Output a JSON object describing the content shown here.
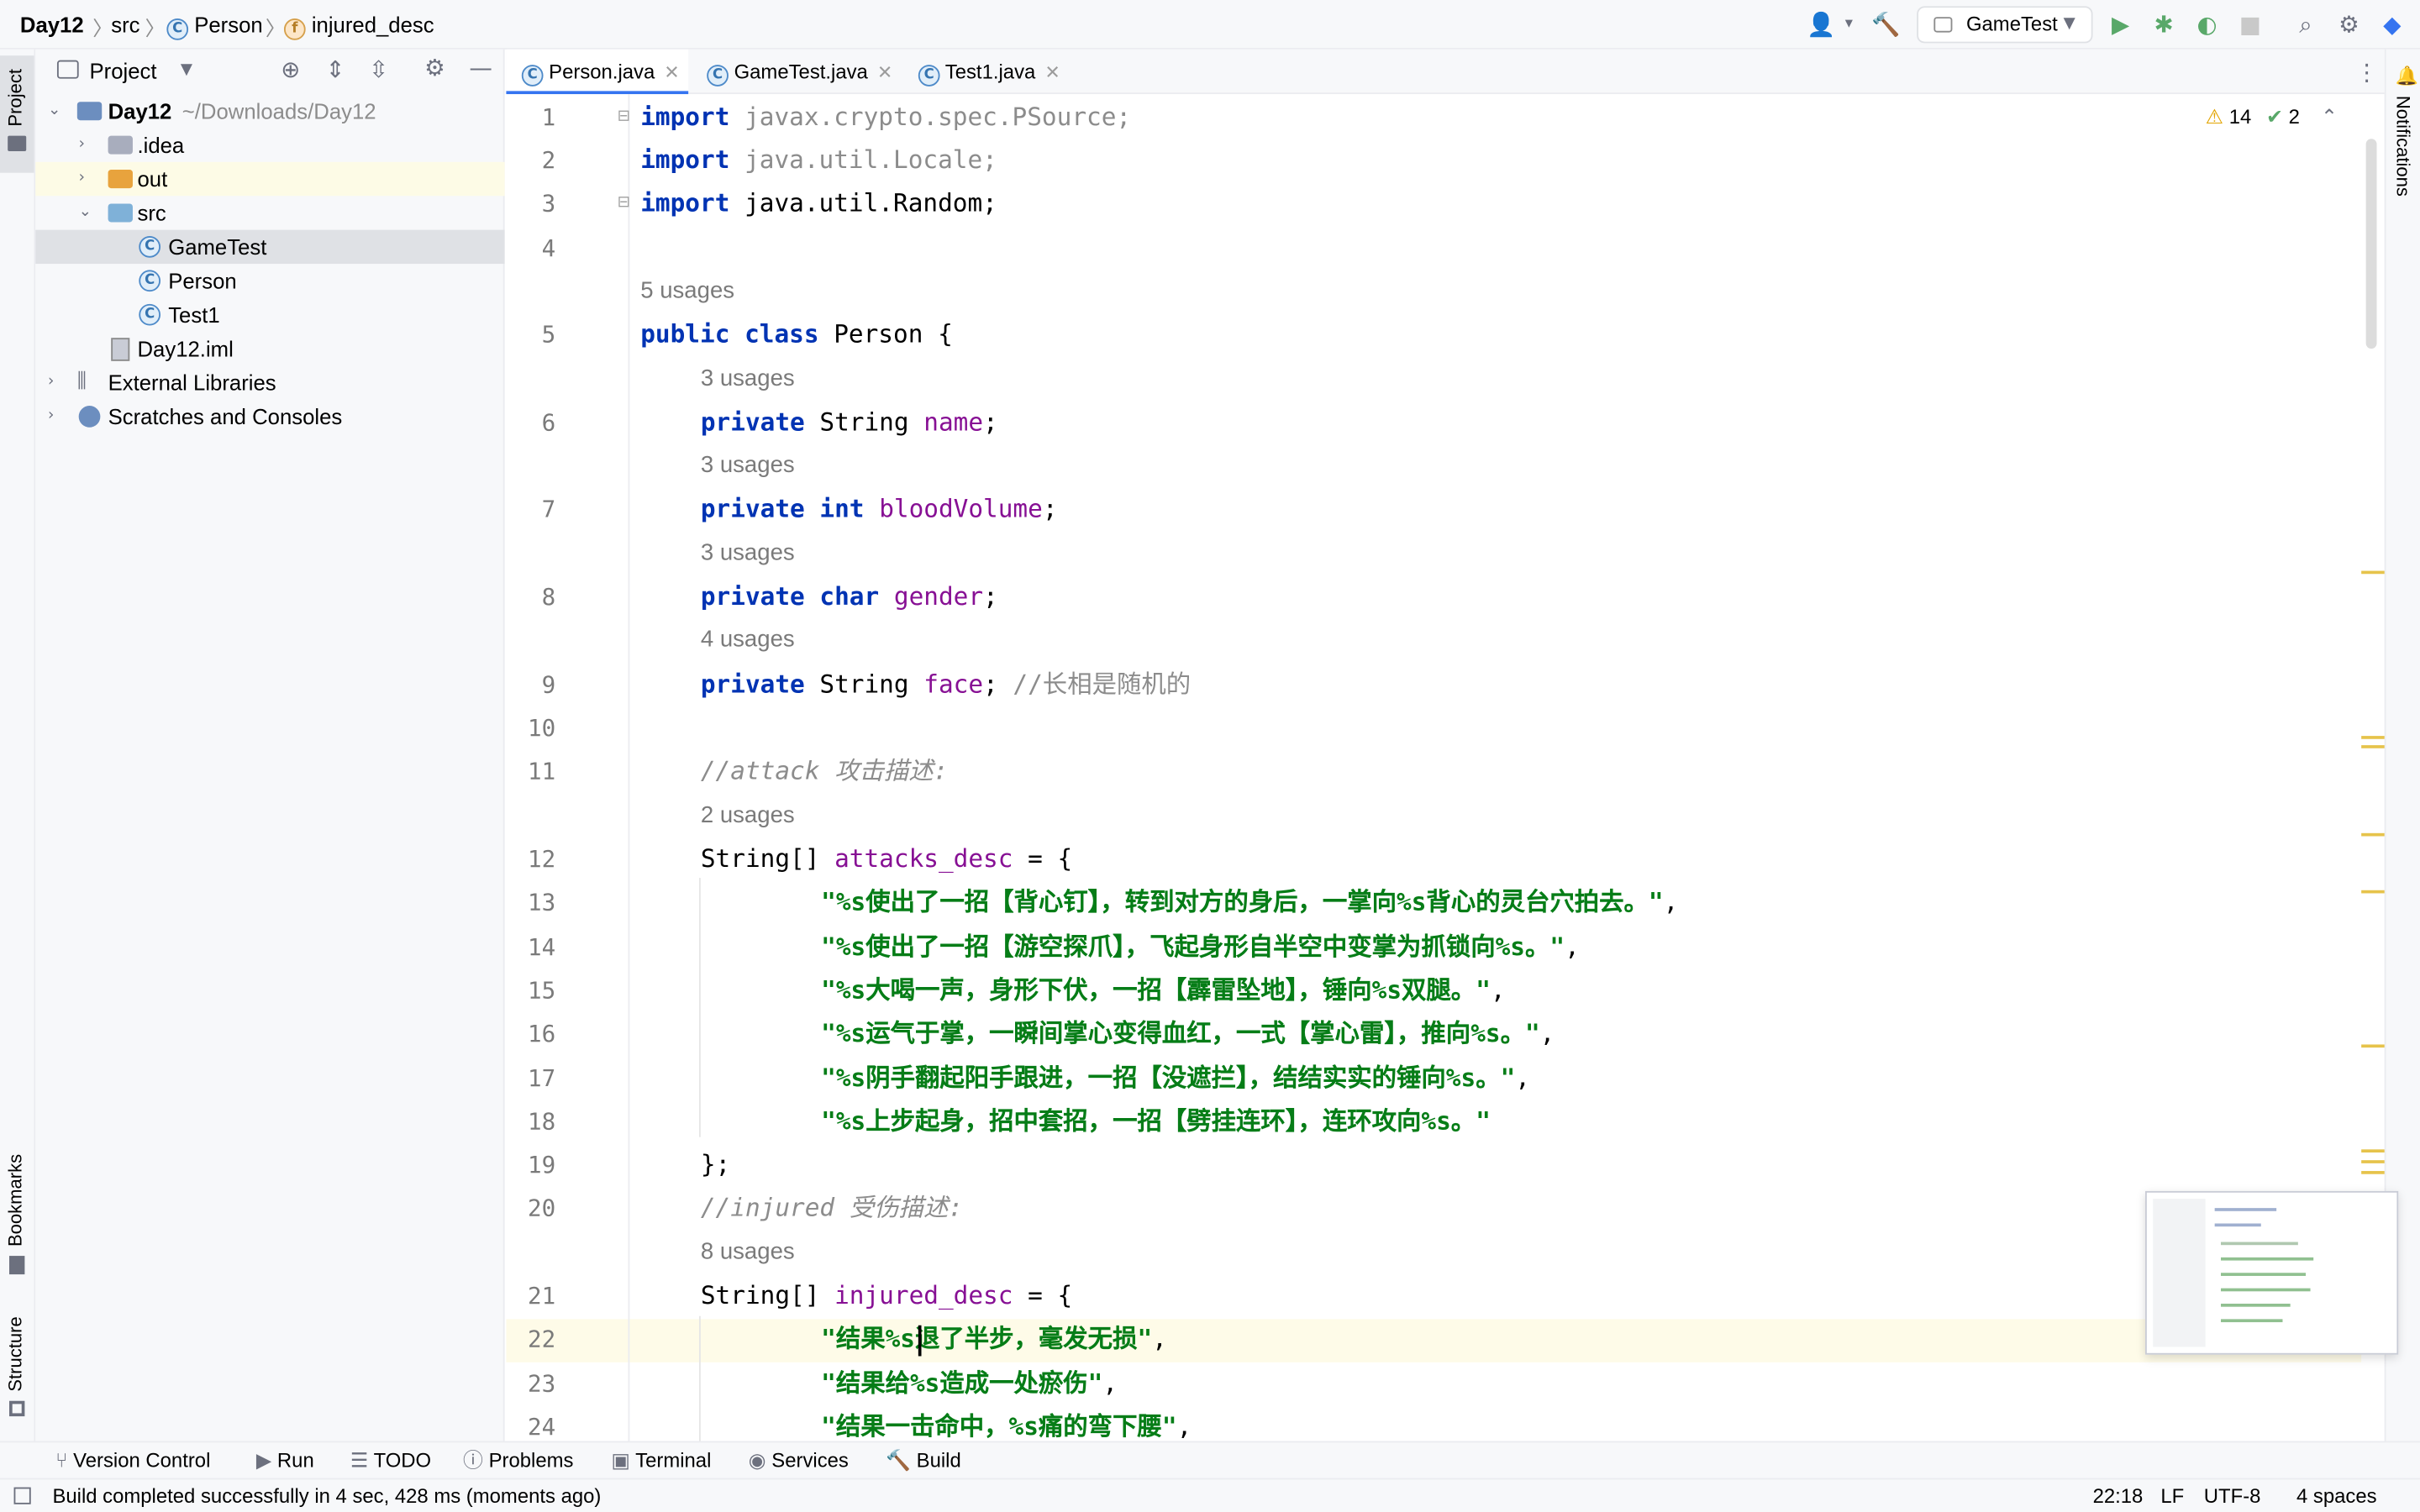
{
  "breadcrumb": {
    "project": "Day12",
    "folder": "src",
    "class": "Person",
    "field": "injured_desc"
  },
  "run_config": "GameTest",
  "left_tools": {
    "project": "Project",
    "bookmarks": "Bookmarks",
    "structure": "Structure"
  },
  "right_tools": {
    "notifications": "Notifications"
  },
  "project_panel": {
    "title": "Project",
    "tree": [
      {
        "label": "Day12",
        "extra": "~/Downloads/Day12"
      },
      {
        "label": ".idea"
      },
      {
        "label": "out"
      },
      {
        "label": "src"
      },
      {
        "label": "GameTest"
      },
      {
        "label": "Person"
      },
      {
        "label": "Test1"
      },
      {
        "label": "Day12.iml"
      },
      {
        "label": "External Libraries"
      },
      {
        "label": "Scratches and Consoles"
      }
    ]
  },
  "tabs": [
    {
      "label": "Person.java"
    },
    {
      "label": "GameTest.java"
    },
    {
      "label": "Test1.java"
    }
  ],
  "inspection": {
    "warnings": "14",
    "ok": "2"
  },
  "code": {
    "l1": {
      "n": "1",
      "kw": "import",
      "t": " javax.crypto.spec.PSource;"
    },
    "l2": {
      "n": "2",
      "kw": "import",
      "t": " java.util.Locale;"
    },
    "l3": {
      "n": "3",
      "kw": "import",
      "t": " java.util.Random;"
    },
    "l4": {
      "n": "4"
    },
    "u5": "5 usages",
    "l5": {
      "n": "5",
      "kw": "public class",
      "t": " Person {"
    },
    "u6": "3 usages",
    "l6": {
      "n": "6",
      "kw": "private",
      "t": " String ",
      "f": "name",
      "e": ";"
    },
    "u7": "3 usages",
    "l7": {
      "n": "7",
      "kw": "private int",
      "f": "bloodVolume",
      "e": ";"
    },
    "u8": "3 usages",
    "l8": {
      "n": "8",
      "kw": "private char",
      "f": "gender",
      "e": ";"
    },
    "u9": "4 usages",
    "l9": {
      "n": "9",
      "kw": "private",
      "t": " String ",
      "f": "face",
      "e": "; ",
      "c": "//长相是随机的"
    },
    "l10": {
      "n": "10"
    },
    "l11": {
      "n": "11",
      "c": "//attack 攻击描述:"
    },
    "u12": "2 usages",
    "l12": {
      "n": "12",
      "t": "String[] ",
      "f": "attacks_desc",
      "e": " = {"
    },
    "l13": {
      "n": "13",
      "s": "\"%s使出了一招【背心钉】，转到对方的身后，一掌向%s背心的灵台穴拍去。\"",
      "e": ","
    },
    "l14": {
      "n": "14",
      "s": "\"%s使出了一招【游空探爪】，飞起身形自半空中变掌为抓锁向%s。\"",
      "e": ","
    },
    "l15": {
      "n": "15",
      "s": "\"%s大喝一声，身形下伏，一招【霹雷坠地】，锤向%s双腿。\"",
      "e": ","
    },
    "l16": {
      "n": "16",
      "s": "\"%s运气于掌，一瞬间掌心变得血红，一式【掌心雷】，推向%s。\"",
      "e": ","
    },
    "l17": {
      "n": "17",
      "s": "\"%s阴手翻起阳手跟进，一招【没遮拦】，结结实实的锤向%s。\"",
      "e": ","
    },
    "l18": {
      "n": "18",
      "s": "\"%s上步起身，招中套招，一招【劈挂连环】，连环攻向%s。\""
    },
    "l19": {
      "n": "19",
      "t": "};"
    },
    "l20": {
      "n": "20",
      "c": "//injured 受伤描述:"
    },
    "u21": "8 usages",
    "l21": {
      "n": "21",
      "t": "String[] ",
      "f": "injured_desc",
      "e": " = {"
    },
    "l22": {
      "n": "22",
      "s": "\"结果%s退了半步，毫发无损\"",
      "e": ","
    },
    "l23": {
      "n": "23",
      "s": "\"结果给%s造成一处瘀伤\"",
      "e": ","
    },
    "l24": {
      "n": "24",
      "s": "\"结果一击命中，%s痛的弯下腰\"",
      "e": ","
    }
  },
  "tool_windows": [
    "Version Control",
    "Run",
    "TODO",
    "Problems",
    "Terminal",
    "Services",
    "Build"
  ],
  "status": {
    "message": "Build completed successfully in 4 sec, 428 ms (moments ago)",
    "position": "22:18",
    "line_sep": "LF",
    "encoding": "UTF-8",
    "indent": "4 spaces"
  },
  "colors": {
    "keyword": "#0033b3",
    "field": "#871094",
    "string": "#067d17",
    "comment": "#8c8c8c",
    "accent": "#3574f0"
  }
}
